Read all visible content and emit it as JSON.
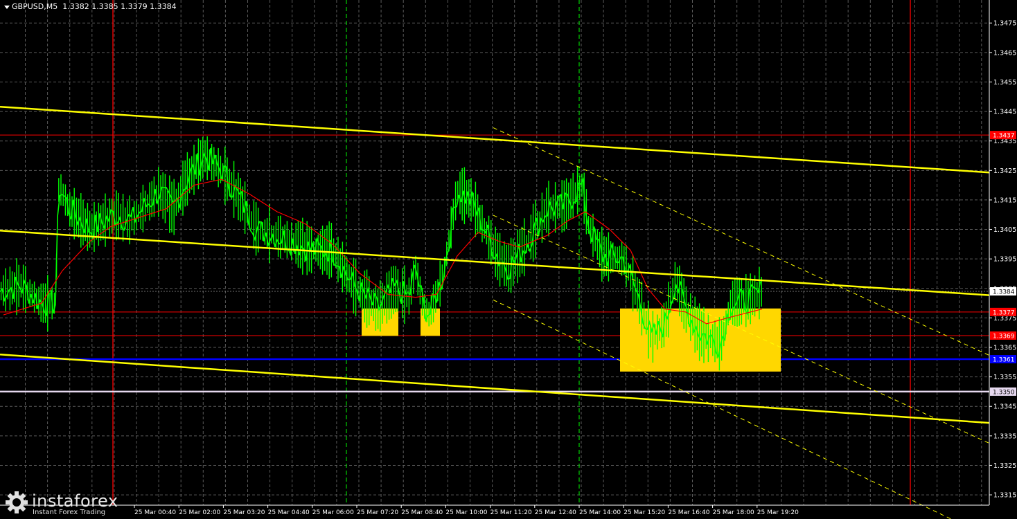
{
  "header": {
    "symbol": "GBPUSD,M5",
    "ohlc": "1.3382 1.3385 1.3379 1.3384"
  },
  "logo": {
    "name": "instaforex",
    "tagline": "Instant Forex Trading",
    "icon": "gear-icon"
  },
  "colors": {
    "background": "#000000",
    "grid": "#5a5a5a",
    "candles": "#00ff00",
    "ma": "#ff0000",
    "trendline": "#ffff00",
    "box": "#ffd700",
    "level_red": "#ff0000",
    "level_blue": "#0000ff",
    "level_lavender": "#e6d8ef",
    "axis_text": "#ffffff"
  },
  "chart_data": {
    "type": "line",
    "y_ticks": [
      "1.3475",
      "1.3465",
      "1.3455",
      "1.3445",
      "1.3435",
      "1.3425",
      "1.3415",
      "1.3405",
      "1.3395",
      "1.3385",
      "1.3375",
      "1.3365",
      "1.3355",
      "1.3345",
      "1.3335",
      "1.3325",
      "1.3315"
    ],
    "x_ticks": [
      "25 Mar 00:40",
      "25 Mar 02:00",
      "25 Mar 03:20",
      "25 Mar 04:40",
      "25 Mar 06:00",
      "25 Mar 07:20",
      "25 Mar 08:40",
      "25 Mar 10:00",
      "25 Mar 11:20",
      "25 Mar 12:40",
      "25 Mar 14:00",
      "25 Mar 15:20",
      "25 Mar 16:40",
      "25 Mar 18:00",
      "25 Mar 19:20"
    ],
    "ylim": [
      1.33115,
      1.34828
    ],
    "current_price_label": "1.3384",
    "price_labels": [
      {
        "text": "1.3437",
        "value": 1.3437,
        "color": "#ff0000"
      },
      {
        "text": "1.3377",
        "value": 1.3377,
        "color": "#ff0000"
      },
      {
        "text": "1.3369",
        "value": 1.3369,
        "color": "#ff0000"
      },
      {
        "text": "1.3361",
        "value": 1.3361,
        "color": "#0000ff"
      },
      {
        "text": "1.3350",
        "value": 1.335,
        "color": "#e6d8ef"
      }
    ],
    "price_path": [
      [
        0,
        1.3384
      ],
      [
        30,
        1.3386
      ],
      [
        60,
        1.338
      ],
      [
        80,
        1.338
      ],
      [
        85,
        1.342
      ],
      [
        100,
        1.3412
      ],
      [
        130,
        1.3405
      ],
      [
        165,
        1.341
      ],
      [
        190,
        1.3408
      ],
      [
        230,
        1.3418
      ],
      [
        250,
        1.3412
      ],
      [
        270,
        1.3422
      ],
      [
        295,
        1.343
      ],
      [
        320,
        1.3425
      ],
      [
        350,
        1.3414
      ],
      [
        370,
        1.3405
      ],
      [
        410,
        1.3402
      ],
      [
        450,
        1.3398
      ],
      [
        480,
        1.3398
      ],
      [
        510,
        1.3386
      ],
      [
        545,
        1.3378
      ],
      [
        570,
        1.3385
      ],
      [
        590,
        1.3382
      ],
      [
        600,
        1.3392
      ],
      [
        610,
        1.338
      ],
      [
        620,
        1.3376
      ],
      [
        640,
        1.339
      ],
      [
        660,
        1.3418
      ],
      [
        680,
        1.3415
      ],
      [
        700,
        1.3405
      ],
      [
        720,
        1.3395
      ],
      [
        735,
        1.3392
      ],
      [
        760,
        1.34
      ],
      [
        790,
        1.3412
      ],
      [
        815,
        1.3413
      ],
      [
        840,
        1.342
      ],
      [
        850,
        1.3406
      ],
      [
        870,
        1.3396
      ],
      [
        900,
        1.3395
      ],
      [
        920,
        1.3383
      ],
      [
        940,
        1.3368
      ],
      [
        960,
        1.3373
      ],
      [
        975,
        1.3388
      ],
      [
        990,
        1.3378
      ],
      [
        1010,
        1.337
      ],
      [
        1040,
        1.3366
      ],
      [
        1055,
        1.338
      ],
      [
        1080,
        1.3381
      ],
      [
        1100,
        1.3384
      ]
    ],
    "moving_average": [
      [
        5,
        1.3376
      ],
      [
        60,
        1.338
      ],
      [
        90,
        1.3391
      ],
      [
        130,
        1.3401
      ],
      [
        160,
        1.3406
      ],
      [
        200,
        1.3409
      ],
      [
        240,
        1.3412
      ],
      [
        280,
        1.342
      ],
      [
        320,
        1.3422
      ],
      [
        360,
        1.3417
      ],
      [
        400,
        1.3411
      ],
      [
        440,
        1.3407
      ],
      [
        480,
        1.34
      ],
      [
        520,
        1.339
      ],
      [
        560,
        1.3383
      ],
      [
        600,
        1.3382
      ],
      [
        630,
        1.3383
      ],
      [
        660,
        1.3396
      ],
      [
        690,
        1.3404
      ],
      [
        720,
        1.3401
      ],
      [
        750,
        1.3399
      ],
      [
        790,
        1.3403
      ],
      [
        820,
        1.3408
      ],
      [
        845,
        1.3411
      ],
      [
        880,
        1.3405
      ],
      [
        910,
        1.3398
      ],
      [
        935,
        1.3385
      ],
      [
        960,
        1.3378
      ],
      [
        990,
        1.3377
      ],
      [
        1020,
        1.3373
      ],
      [
        1050,
        1.3375
      ],
      [
        1100,
        1.3378
      ]
    ],
    "vertical_lines": [
      {
        "x": 163,
        "color": "#ff0000",
        "style": "solid"
      },
      {
        "x": 500,
        "color": "#00c000",
        "style": "dashed"
      },
      {
        "x": 836,
        "color": "#00c000",
        "style": "dashed"
      },
      {
        "x": 1314,
        "color": "#ff0000",
        "style": "solid"
      }
    ],
    "trendlines": [
      {
        "from": [
          0,
          1.34466
        ],
        "to": [
          1428,
          1.34243
        ],
        "style": "solid"
      },
      {
        "from": [
          0,
          1.34046
        ],
        "to": [
          1428,
          1.33827
        ],
        "style": "solid"
      },
      {
        "from": [
          0,
          1.33626
        ],
        "to": [
          1428,
          1.33394
        ],
        "style": "solid"
      },
      {
        "from": [
          712,
          1.34395
        ],
        "to": [
          1428,
          1.33623
        ],
        "style": "dashed"
      },
      {
        "from": [
          712,
          1.34098
        ],
        "to": [
          1428,
          1.33325
        ],
        "style": "dashed"
      },
      {
        "from": [
          712,
          1.33811
        ],
        "to": [
          1428,
          1.33006
        ],
        "style": "dashed"
      }
    ],
    "boxes": [
      {
        "x0": 522,
        "x1": 575,
        "top": 1.33782,
        "bottom": 1.33689
      },
      {
        "x0": 607,
        "x1": 635,
        "top": 1.33782,
        "bottom": 1.33689
      },
      {
        "x0": 895,
        "x1": 1127,
        "top": 1.33782,
        "bottom": 1.33568
      }
    ]
  }
}
